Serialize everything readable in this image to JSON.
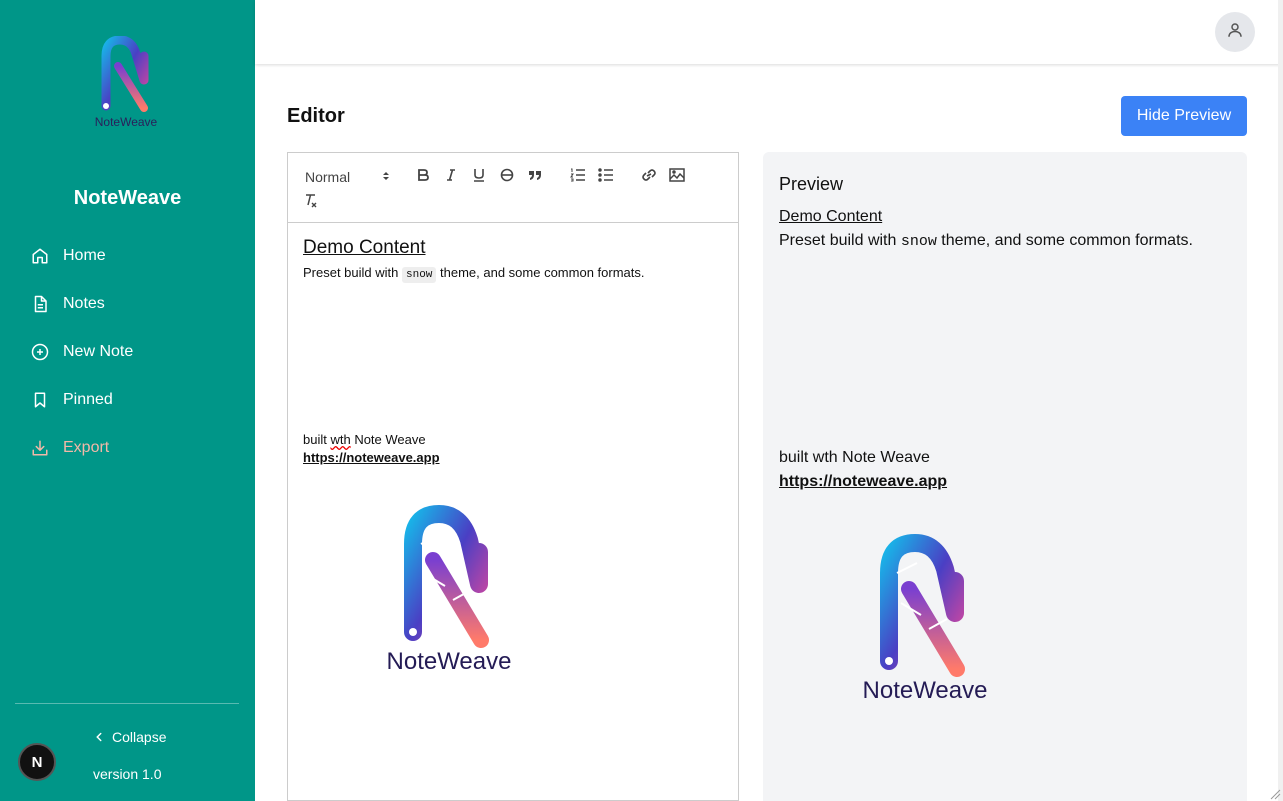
{
  "sidebar": {
    "logo_text": "NoteWeave",
    "brand": "NoteWeave",
    "items": [
      {
        "label": "Home",
        "icon": "home-icon"
      },
      {
        "label": "Notes",
        "icon": "file-text-icon"
      },
      {
        "label": "New Note",
        "icon": "plus-circle-icon"
      },
      {
        "label": "Pinned",
        "icon": "bookmark-icon"
      },
      {
        "label": "Export",
        "icon": "download-icon"
      }
    ],
    "collapse_label": "Collapse",
    "version": "version 1.0",
    "badge_letter": "N"
  },
  "header": {
    "avatar_icon": "user-icon"
  },
  "main": {
    "title": "Editor",
    "hide_preview_label": "Hide Preview"
  },
  "editor": {
    "toolbar": {
      "format_select": "Normal",
      "buttons": [
        "bold",
        "italic",
        "underline",
        "strike",
        "blockquote",
        "ordered-list",
        "bullet-list",
        "link",
        "image",
        "clean"
      ]
    },
    "content": {
      "title": "Demo Content",
      "line_before": "Preset build with ",
      "code": "snow",
      "line_after": " theme, and some common formats.",
      "built_prefix": "built ",
      "built_misspelled": "wth",
      "built_suffix": " Note Weave",
      "link": "https://noteweave.app",
      "logo_text": "NoteWeave",
      "logo_tm": "™"
    }
  },
  "preview": {
    "heading": "Preview",
    "title": "Demo Content",
    "line_before": "Preset build with ",
    "code": "snow",
    "line_after": " theme, and some common formats.",
    "built": "built wth Note Weave",
    "link": "https://noteweave.app",
    "logo_text": "NoteWeave",
    "logo_tm": "™"
  },
  "colors": {
    "sidebar_bg": "#009688",
    "accent": "#3b82f6",
    "preview_bg": "#f3f4f6",
    "export_text": "#f2b8a8"
  }
}
